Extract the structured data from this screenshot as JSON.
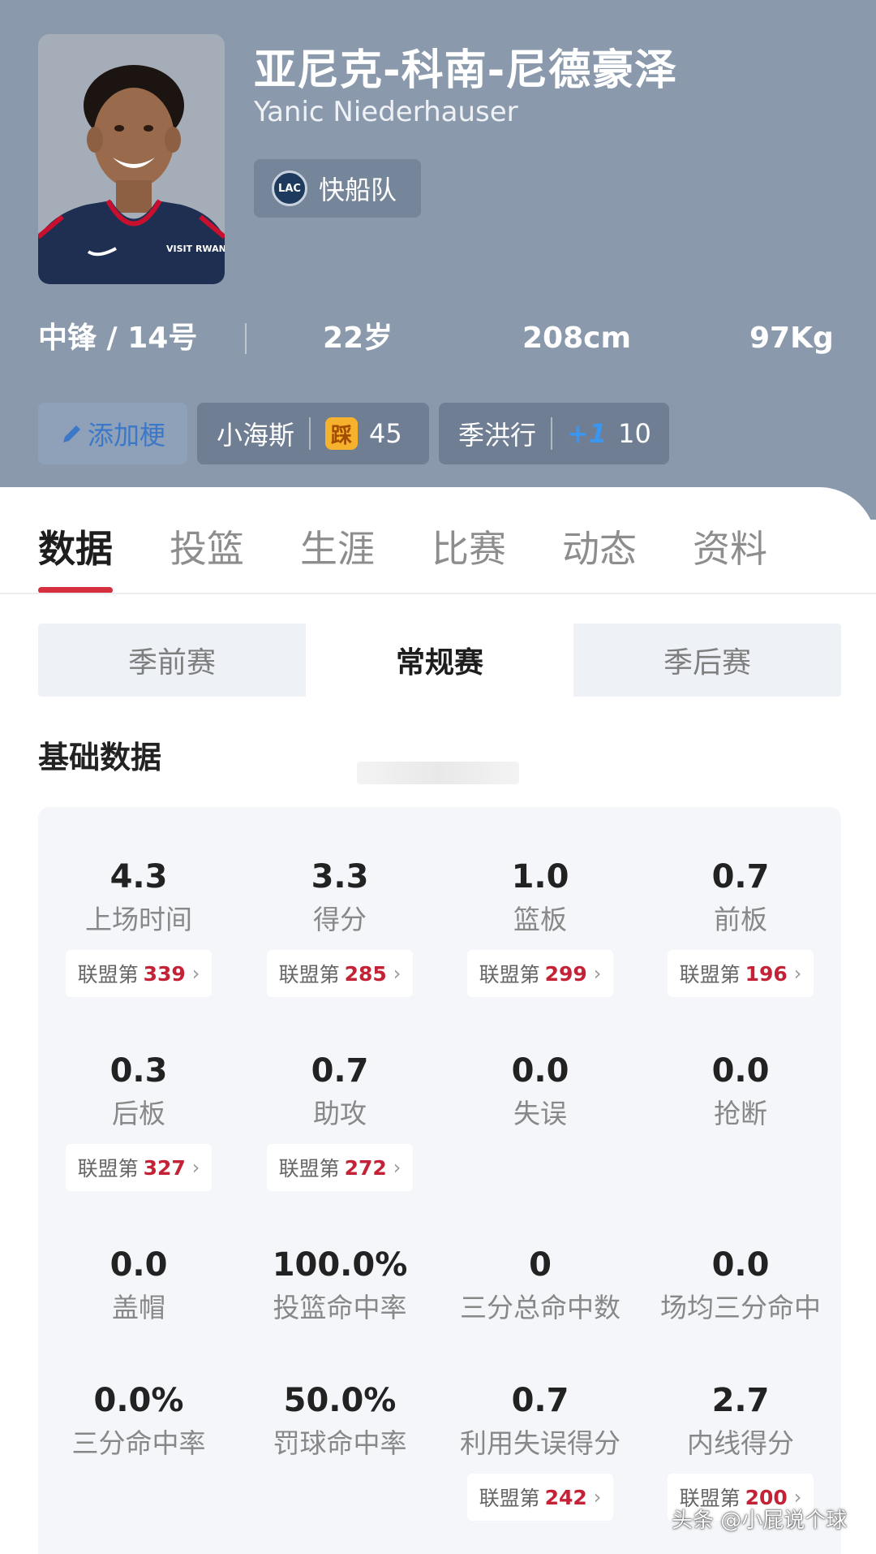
{
  "player": {
    "name_cn": "亚尼克-科南-尼德豪泽",
    "name_en": "Yanic Niederhauser",
    "team": "快船队",
    "team_logo_text": "LAC",
    "jersey_text": "VISIT RWANDA"
  },
  "info": {
    "position": "中锋 / 14号",
    "age": "22岁",
    "height": "208cm",
    "weight": "97Kg"
  },
  "chips": {
    "add_label": "添加梗",
    "nickname1": "小海斯",
    "badge1_text": "踩",
    "count1": "45",
    "nickname2": "季洪行",
    "badge2_text": "+1",
    "count2": "10"
  },
  "tabs": [
    "数据",
    "投篮",
    "生涯",
    "比赛",
    "动态",
    "资料"
  ],
  "segments": [
    "季前赛",
    "常规赛",
    "季后赛"
  ],
  "section_title": "基础数据",
  "rank_prefix": "联盟第",
  "stats": [
    {
      "value": "4.3",
      "label": "上场时间",
      "rank": "339"
    },
    {
      "value": "3.3",
      "label": "得分",
      "rank": "285"
    },
    {
      "value": "1.0",
      "label": "篮板",
      "rank": "299"
    },
    {
      "value": "0.7",
      "label": "前板",
      "rank": "196"
    },
    {
      "value": "0.3",
      "label": "后板",
      "rank": "327"
    },
    {
      "value": "0.7",
      "label": "助攻",
      "rank": "272"
    },
    {
      "value": "0.0",
      "label": "失误",
      "rank": ""
    },
    {
      "value": "0.0",
      "label": "抢断",
      "rank": ""
    },
    {
      "value": "0.0",
      "label": "盖帽",
      "rank": ""
    },
    {
      "value": "100.0%",
      "label": "投篮命中率",
      "rank": ""
    },
    {
      "value": "0",
      "label": "三分总命中数",
      "rank": ""
    },
    {
      "value": "0.0",
      "label": "场均三分命中",
      "rank": ""
    },
    {
      "value": "0.0%",
      "label": "三分命中率",
      "rank": ""
    },
    {
      "value": "50.0%",
      "label": "罚球命中率",
      "rank": ""
    },
    {
      "value": "0.7",
      "label": "利用失误得分",
      "rank": "242"
    },
    {
      "value": "2.7",
      "label": "内线得分",
      "rank": "200"
    }
  ],
  "watermark": "头条 @小屁说个球",
  "colors": {
    "header_bg": "#8a99ac",
    "accent_red": "#d63040",
    "rank_red": "#c42236",
    "panel_bg": "#f4f6f9"
  }
}
